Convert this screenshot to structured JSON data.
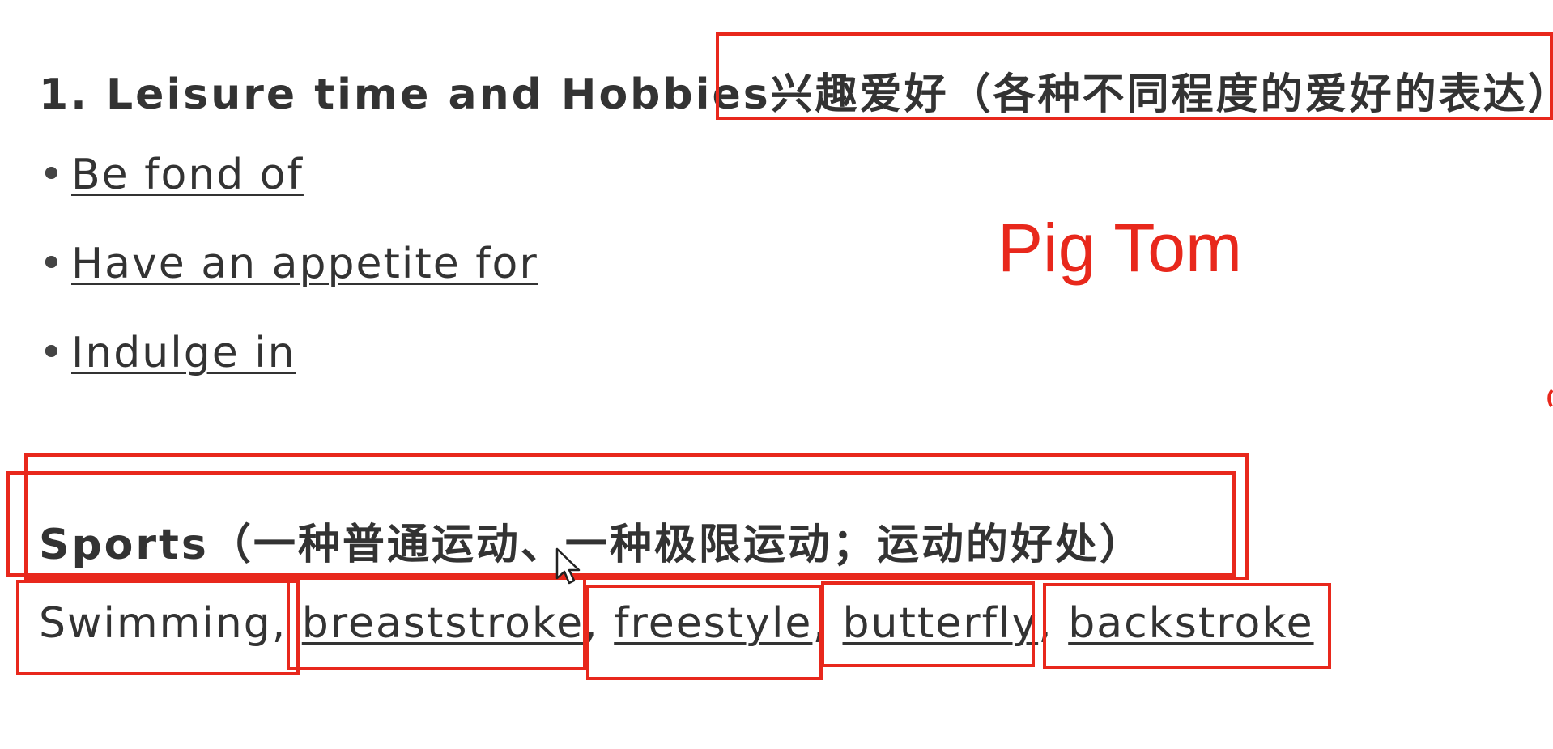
{
  "heading": {
    "text": "1. Leisure time and Hobbies兴趣爱好（各种不同程度的爱好的表达）"
  },
  "bullets": [
    {
      "symbol": "•",
      "text": "Be fond of"
    },
    {
      "symbol": "•",
      "text": "Have an appetite for"
    },
    {
      "symbol": "•",
      "text": "Indulge in"
    }
  ],
  "watermark": {
    "text": "Pig Tom"
  },
  "sports": {
    "title": "Sports（一种普通运动、一种极限运动；运动的好处）",
    "first_word": "Swimming,",
    "strokes": [
      {
        "text": "breaststroke",
        "sep": ", "
      },
      {
        "text": "freestyle",
        "sep": ", "
      },
      {
        "text": "butterfly",
        "sep": ", "
      },
      {
        "text": "backstroke",
        "sep": ""
      }
    ]
  },
  "colors": {
    "annotation_red": "#e8281c",
    "text_dark": "#333333"
  }
}
